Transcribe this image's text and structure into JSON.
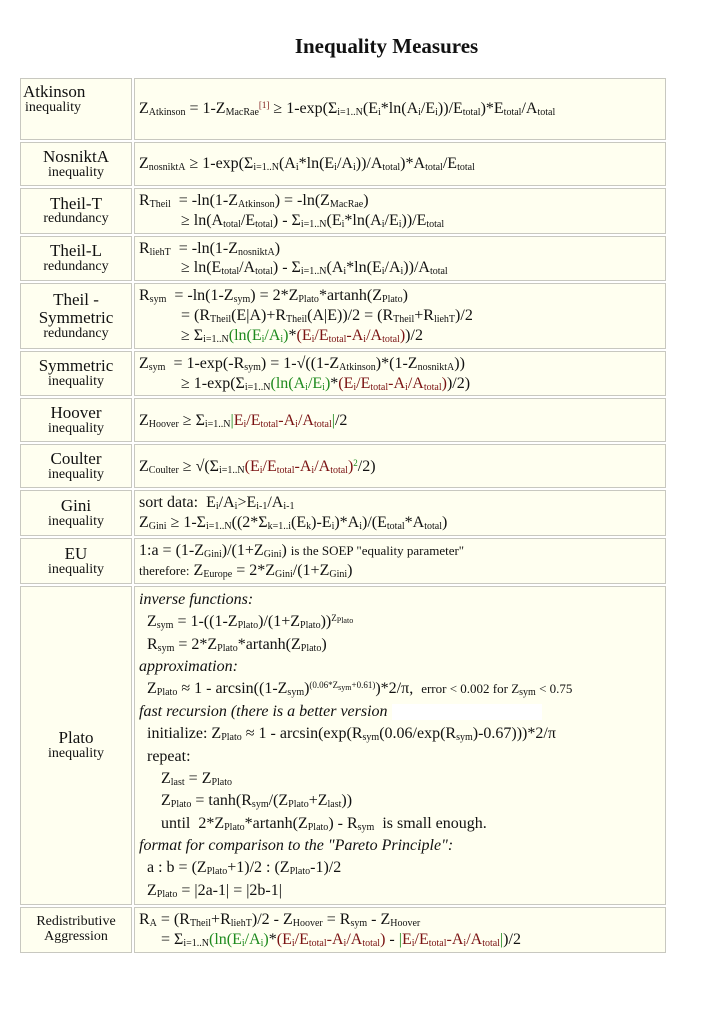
{
  "title": "Inequality Measures",
  "colors": {
    "cell_bg": "#fffff0",
    "border": "#c8c8c0",
    "green": "#1e8a1e",
    "dark_red": "#7a1212"
  },
  "rows": [
    {
      "name": "Atkinson",
      "kind": "inequality",
      "lines": [
        "Z_Atkinson = 1-Z_MacRae^[1] ≥ 1-exp(Σ_i=1..N(E_i*ln(A_i/E_i))/E_total)*E_total/A_total"
      ]
    },
    {
      "name": "NosniktA",
      "kind": "inequality",
      "lines": [
        "Z_nosniktA ≥ 1-exp(Σ_i=1..N(A_i*ln(E_i/A_i))/A_total)*A_total/E_total"
      ]
    },
    {
      "name": "Theil-T",
      "kind": "redundancy",
      "lines": [
        "R_Theil = -ln(1-Z_Atkinson) = -ln(Z_MacRae)",
        "≥ ln(A_total/E_total) - Σ_i=1..N(E_i*ln(A_i/E_i))/E_total"
      ]
    },
    {
      "name": "Theil-L",
      "kind": "redundancy",
      "lines": [
        "R_liehT = -ln(1-Z_nosniktA)",
        "≥ ln(E_total/A_total) - Σ_i=1..N(A_i*ln(E_i/A_i))/A_total"
      ]
    },
    {
      "name": "Theil - Symmetric",
      "kind": "redundancy",
      "lines": [
        "R_sym = -ln(1-Z_sym) = 2*Z_Plato*artanh(Z_Plato)",
        "= (R_Theil(E|A)+R_Theil(A|E))/2 = (R_Theil+R_liehT)/2",
        "≥ Σ_i=1..N(ln(E_i/A_i)*(E_i/E_total-A_i/A_total))/2"
      ]
    },
    {
      "name": "Symmetric",
      "kind": "inequality",
      "lines": [
        "Z_sym = 1-exp(-R_sym) = 1-√((1-Z_Atkinson)*(1-Z_nosniktA))",
        "≥ 1-exp(Σ_i=1..N(ln(A_i/E_i)*(E_i/E_total-A_i/A_total))/2)"
      ]
    },
    {
      "name": "Hoover",
      "kind": "inequality",
      "lines": [
        "Z_Hoover ≥ Σ_i=1..N|E_i/E_total-A_i/A_total|/2"
      ]
    },
    {
      "name": "Coulter",
      "kind": "inequality",
      "lines": [
        "Z_Coulter ≥ √(Σ_i=1..N(E_i/E_total-A_i/A_total)²/2)"
      ]
    },
    {
      "name": "Gini",
      "kind": "inequality",
      "lines": [
        "sort data: E_i/A_i>E_i-1/A_i-1",
        "Z_Gini ≥ 1-Σ_i=1..N((2*Σ_k=1..i(E_k)-E_i)*A_i)/(E_total*A_total)"
      ]
    },
    {
      "name": "EU",
      "kind": "inequality",
      "lines": [
        "1:a = (1-Z_Gini)/(1+Z_Gini) is the SOEP \"equality parameter\"",
        "therefore: Z_Europe = 2*Z_Gini/(1+Z_Gini)"
      ]
    },
    {
      "name": "Plato",
      "kind": "inequality",
      "lines": [
        "inverse functions:",
        "Z_sym = 1-((1-Z_Plato)/(1+Z_Plato))^Z_Plato",
        "R_sym = 2*Z_Plato*artanh(Z_Plato)",
        "approximation:",
        "Z_Plato ≈ 1 - arcsin((1-Z_sym)^(0.06*Z_sym+0.61))*2/π, error < 0.002 for Z_sym < 0.75",
        "fast recursion (there is a better version",
        "initialize: Z_Plato ≈ 1 - arcsin(exp(R_sym(0.06/exp(R_sym)-0.67)))*2/π",
        "repeat:",
        "Z_last = Z_Plato",
        "Z_Plato = tanh(R_sym/(Z_Plato+Z_last))",
        "until 2*Z_Plato*artanh(Z_Plato) - R_sym is small enough.",
        "format for comparison to the \"Pareto Principle\":",
        "a : b = (Z_Plato+1)/2 : (Z_Plato-1)/2",
        "Z_Plato = |2a-1| = |2b-1|"
      ]
    },
    {
      "name": "Redistributive",
      "kind": "Aggression",
      "lines": [
        "R_A = (R_Theil+R_liehT)/2 - Z_Hoover = R_sym - Z_Hoover",
        "= Σ_i=1..N(ln(E_i/A_i)*(E_i/E_total-A_i/A_total) - |E_i/E_total-A_i/A_total|)/2"
      ]
    }
  ],
  "t": {
    "Z": "Z",
    "R": "R",
    "E": "E",
    "A": "A",
    "Atkinson": "Atkinson",
    "MacRae": "MacRae",
    "nosniktA": "nosniktA",
    "Theil": "Theil",
    "liehT": "liehT",
    "sym": "sym",
    "Plato": "Plato",
    "Hoover": "Hoover",
    "Coulter": "Coulter",
    "Gini": "Gini",
    "Europe": "Europe",
    "last": "last",
    "total": "total",
    "i": "i",
    "k": "k",
    "i1": "i-1",
    "sumN": "i=1..N",
    "sumK": "k=1..i",
    "RA": "A",
    "fn1": "[1]",
    "sig": "Σ",
    "exp_plato": "(0.06*Z",
    "exp_plato2": "+0.61)",
    "sq2": "2"
  }
}
